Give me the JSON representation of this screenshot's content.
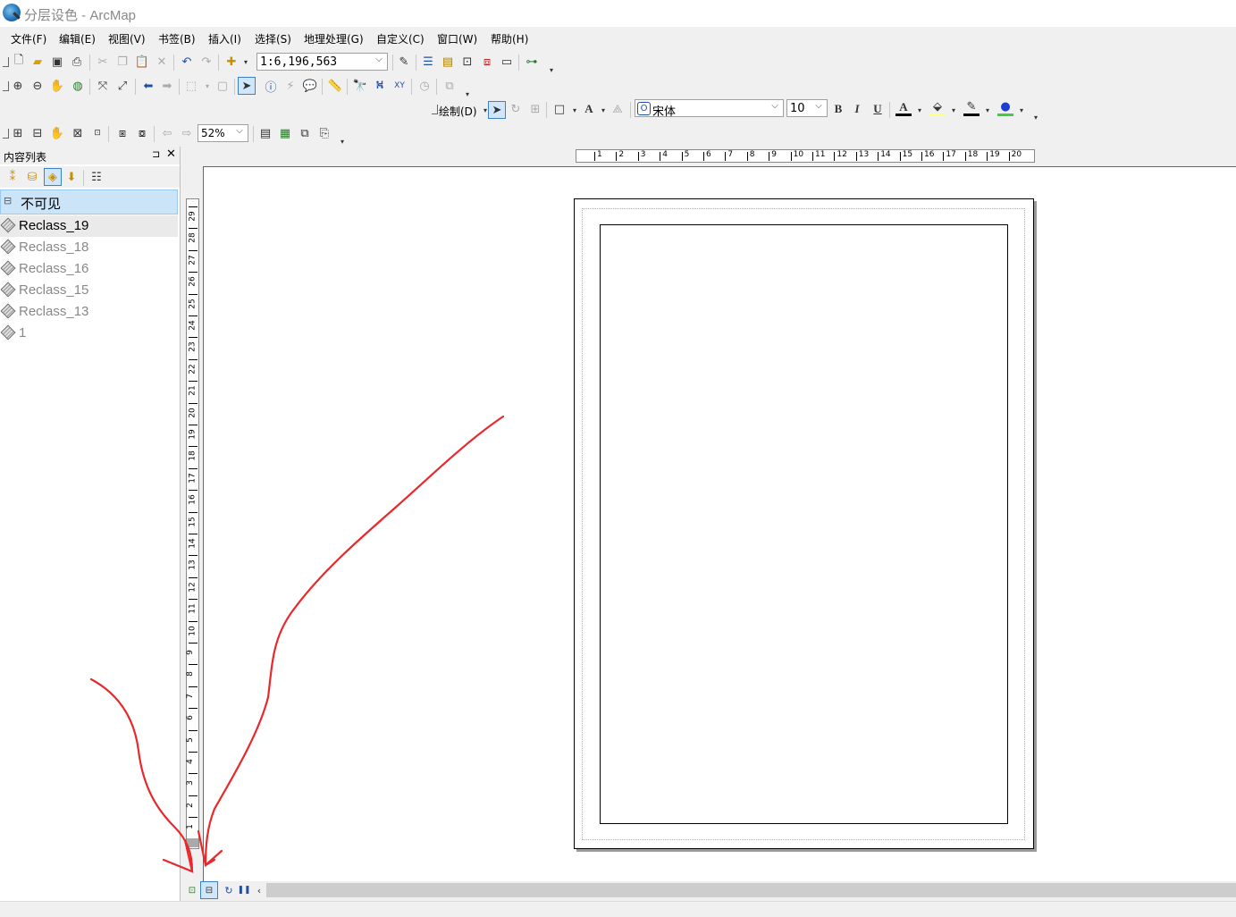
{
  "window": {
    "title": "分层设色 - ArcMap"
  },
  "menu": [
    "文件(F)",
    "编辑(E)",
    "视图(V)",
    "书签(B)",
    "插入(I)",
    "选择(S)",
    "地理处理(G)",
    "自定义(C)",
    "窗口(W)",
    "帮助(H)"
  ],
  "standard_toolbar": {
    "scale_value": "1:6,196,563"
  },
  "draw_toolbar": {
    "label": "绘制(D)",
    "font_name": "宋体",
    "font_size": "10",
    "bold": "B",
    "italic": "I",
    "underline": "U",
    "text_tool": "A"
  },
  "layout_toolbar": {
    "zoom_value": "52%"
  },
  "toc": {
    "title": "内容列表",
    "pin": "⊐",
    "close": "✕",
    "group": {
      "toggle": "⊟",
      "name": "不可见"
    },
    "layers": [
      "Reclass_19",
      "Reclass_18",
      "Reclass_16",
      "Reclass_15",
      "Reclass_13",
      "1"
    ]
  },
  "ruler": {
    "h_numbers": [
      "1",
      "2",
      "3",
      "4",
      "5",
      "6",
      "7",
      "8",
      "9",
      "10",
      "11",
      "12",
      "13",
      "14",
      "15",
      "16",
      "17",
      "18",
      "19",
      "20"
    ],
    "v_numbers": [
      "29",
      "28",
      "27",
      "26",
      "25",
      "24",
      "23",
      "22",
      "21",
      "20",
      "19",
      "18",
      "17",
      "16",
      "15",
      "14",
      "13",
      "12",
      "11",
      "10",
      "9",
      "8",
      "7",
      "6",
      "5",
      "4",
      "3",
      "2",
      "1"
    ]
  },
  "colors": {
    "selection": "#cce4f7",
    "annotation": "#e8282b"
  },
  "icons": {
    "bottom": [
      "data-view-icon",
      "layout-view-icon",
      "refresh-icon",
      "pause-icon",
      "scroll-left-icon"
    ]
  }
}
